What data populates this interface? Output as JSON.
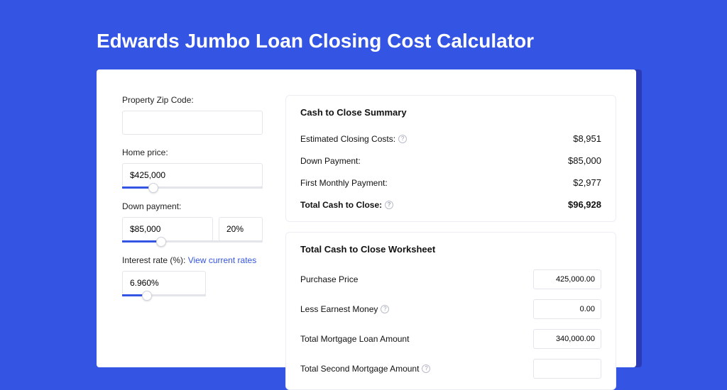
{
  "title": "Edwards Jumbo Loan Closing Cost Calculator",
  "form": {
    "zip_label": "Property Zip Code:",
    "zip_value": "",
    "home_price_label": "Home price:",
    "home_price_value": "$425,000",
    "home_price_slider_pct": 22,
    "down_payment_label": "Down payment:",
    "down_payment_value": "$85,000",
    "down_payment_pct": "20%",
    "down_payment_slider_pct": 28,
    "interest_label": "Interest rate (%):",
    "interest_link": "View current rates",
    "interest_value": "6.960%",
    "interest_slider_pct": 30
  },
  "summary": {
    "heading": "Cash to Close Summary",
    "rows": [
      {
        "label": "Estimated Closing Costs:",
        "help": true,
        "value": "$8,951",
        "bold": false
      },
      {
        "label": "Down Payment:",
        "help": false,
        "value": "$85,000",
        "bold": false
      },
      {
        "label": "First Monthly Payment:",
        "help": false,
        "value": "$2,977",
        "bold": false
      },
      {
        "label": "Total Cash to Close:",
        "help": true,
        "value": "$96,928",
        "bold": true
      }
    ]
  },
  "worksheet": {
    "heading": "Total Cash to Close Worksheet",
    "rows": [
      {
        "label": "Purchase Price",
        "help": false,
        "value": "425,000.00"
      },
      {
        "label": "Less Earnest Money",
        "help": true,
        "value": "0.00"
      },
      {
        "label": "Total Mortgage Loan Amount",
        "help": false,
        "value": "340,000.00"
      },
      {
        "label": "Total Second Mortgage Amount",
        "help": true,
        "value": ""
      }
    ]
  }
}
